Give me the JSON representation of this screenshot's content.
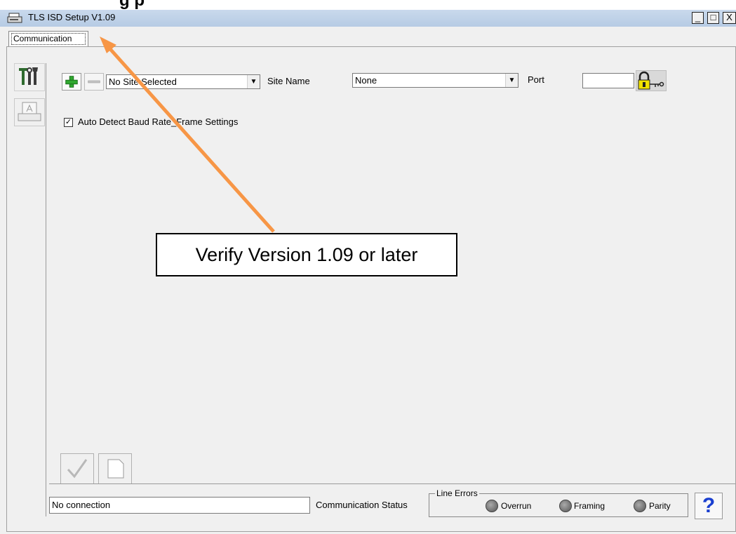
{
  "window": {
    "title": "TLS ISD Setup V1.09",
    "minimize_label": "_",
    "maximize_label": "□",
    "close_label": "X"
  },
  "header_text": "g                                        p",
  "tabs": [
    {
      "label": "Communication"
    }
  ],
  "site": {
    "selector_value": "No Site Selected",
    "site_name_label": "Site Name",
    "site_name_value": "None",
    "port_label": "Port",
    "port_value": ""
  },
  "auto_detect": {
    "label": "Auto Detect Baud Rate_Frame Settings",
    "checked": true
  },
  "annotation": {
    "text": "Verify Version 1.09 or later",
    "arrow_color": "#f79646"
  },
  "status": {
    "connection_value": "No connection",
    "label": "Communication Status"
  },
  "line_errors": {
    "title": "Line Errors",
    "items": [
      {
        "label": "Overrun"
      },
      {
        "label": "Framing"
      },
      {
        "label": "Parity"
      }
    ]
  },
  "help_label": "?",
  "icons": {
    "add": "plus-icon",
    "remove": "minus-icon",
    "tools": "tools-icon",
    "print": "print-icon",
    "lock": "lock-icon",
    "apply": "checkmark-icon",
    "new": "blank-page-icon"
  },
  "colors": {
    "titlebar": "#b6cbe4",
    "add_green": "#2fa82f",
    "lock_yellow": "#f2e300",
    "help_blue": "#1a3fd0"
  }
}
